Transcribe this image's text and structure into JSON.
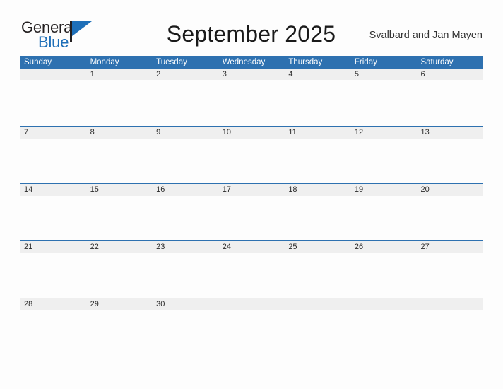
{
  "brand": {
    "name_part1": "General",
    "name_part2": "Blue",
    "mark": "flag-triangle-icon",
    "accent_color": "#1e6fb8"
  },
  "header": {
    "title": "September 2025",
    "region": "Svalbard and Jan Mayen"
  },
  "colors": {
    "header_blue": "#2e71b0",
    "row_band_gray": "#efefef",
    "page_background": "#fdfdfd",
    "title_text": "#1a1a1a"
  },
  "calendar": {
    "month": "September",
    "year": "2025",
    "day_names": [
      "Sunday",
      "Monday",
      "Tuesday",
      "Wednesday",
      "Thursday",
      "Friday",
      "Saturday"
    ],
    "weeks": [
      [
        "",
        "1",
        "2",
        "3",
        "4",
        "5",
        "6"
      ],
      [
        "7",
        "8",
        "9",
        "10",
        "11",
        "12",
        "13"
      ],
      [
        "14",
        "15",
        "16",
        "17",
        "18",
        "19",
        "20"
      ],
      [
        "21",
        "22",
        "23",
        "24",
        "25",
        "26",
        "27"
      ],
      [
        "28",
        "29",
        "30",
        "",
        "",
        "",
        ""
      ]
    ]
  }
}
